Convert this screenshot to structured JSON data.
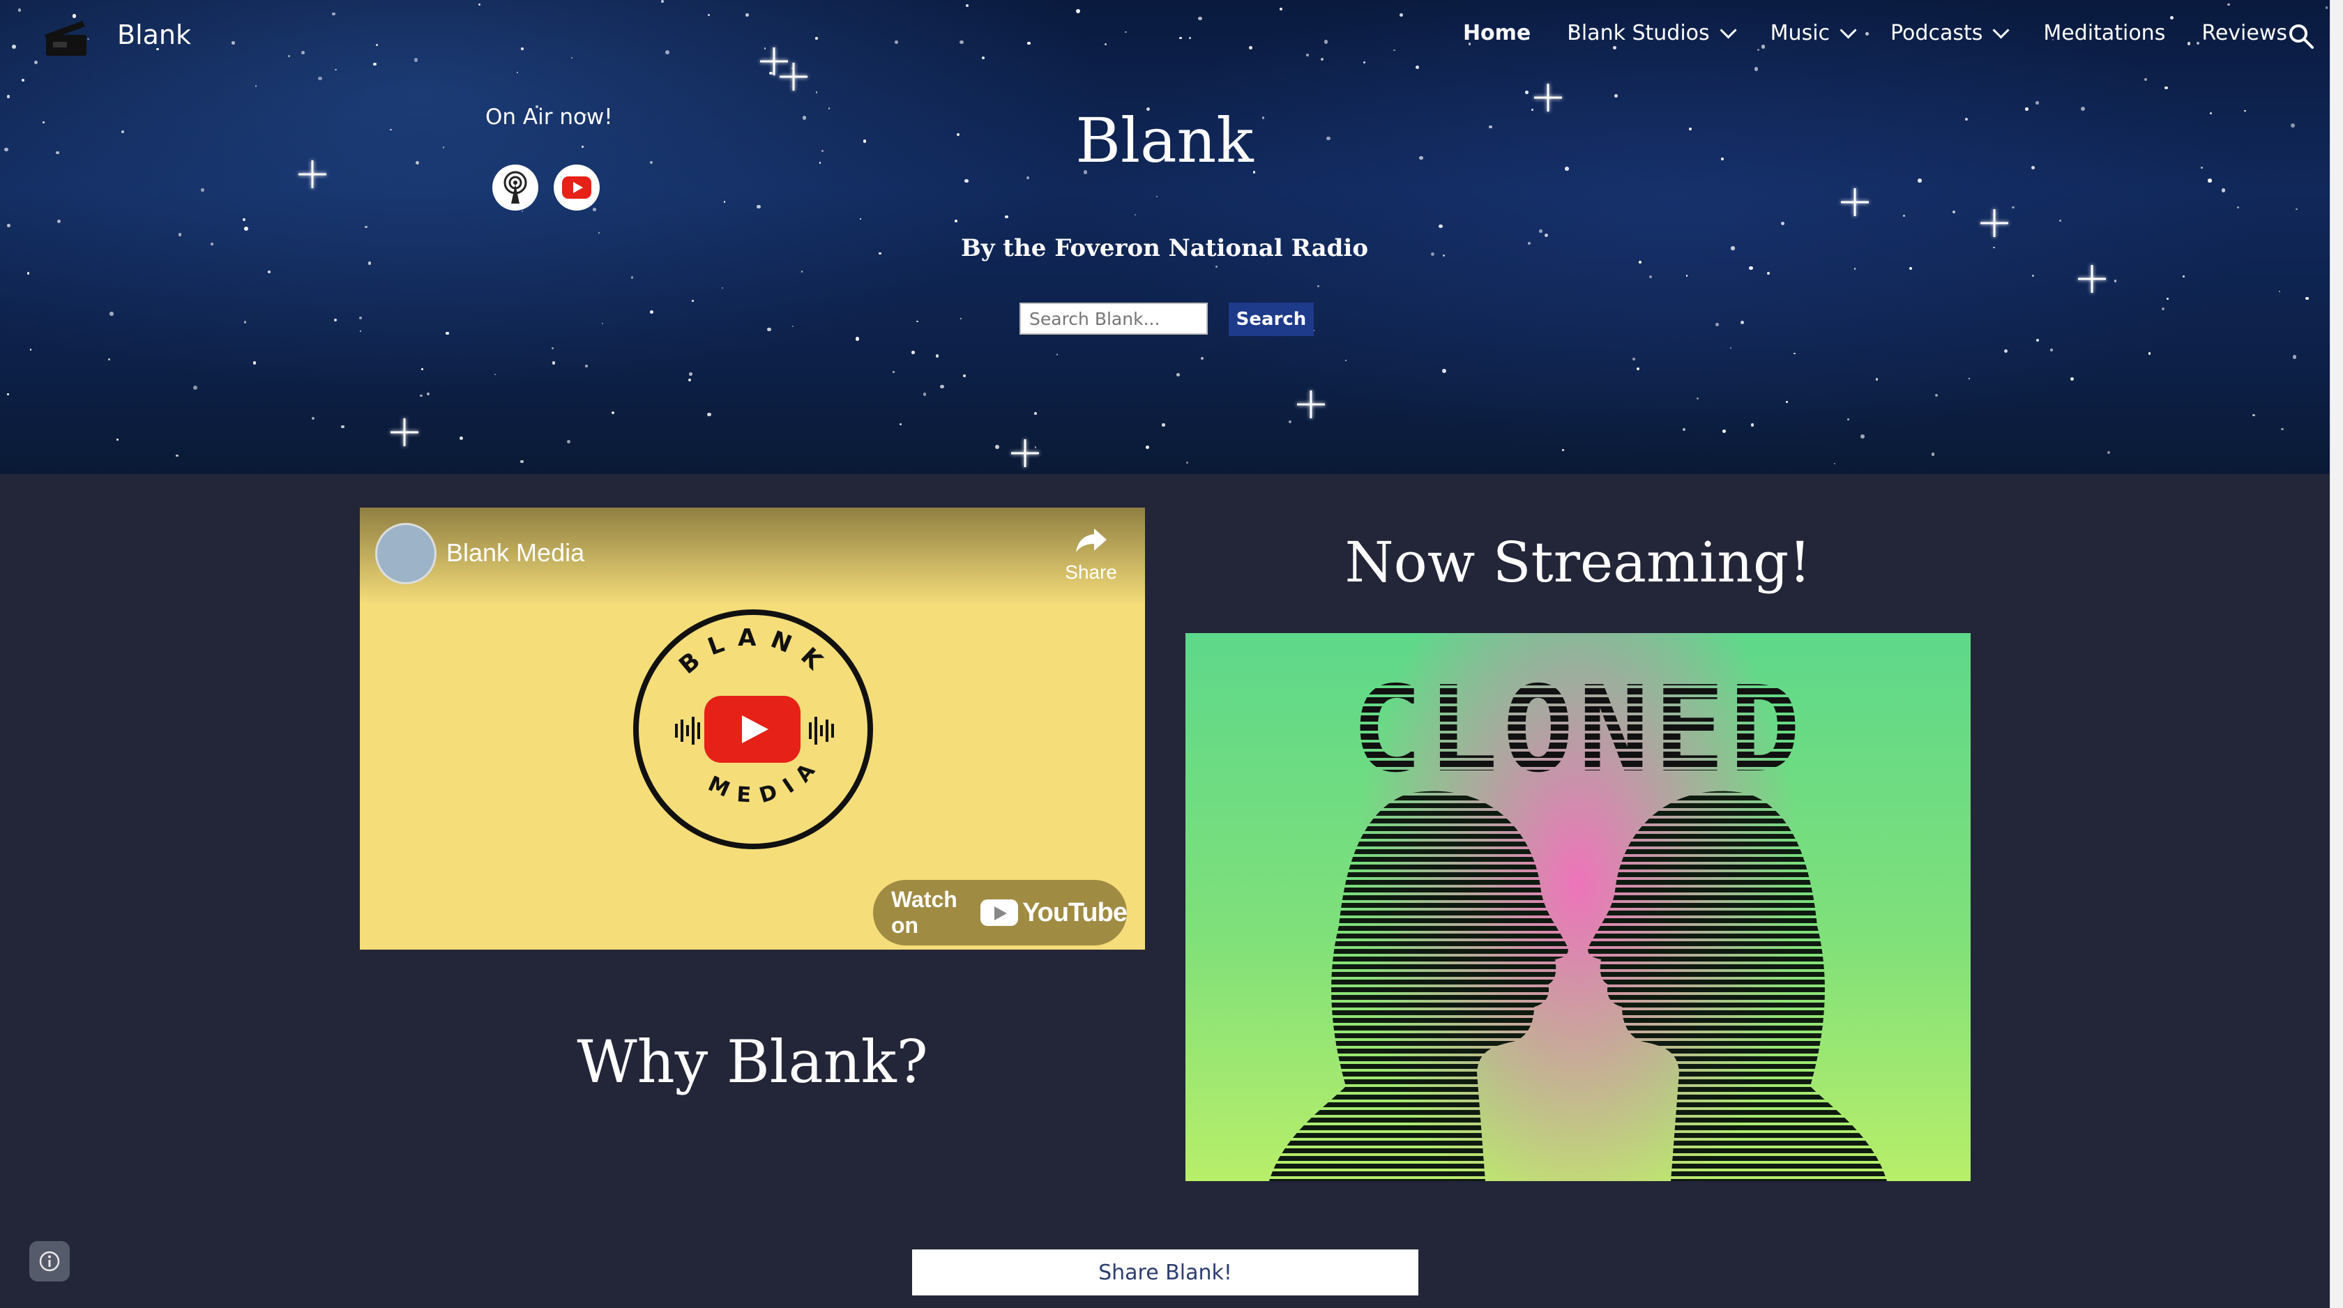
{
  "site": {
    "title": "Blank"
  },
  "nav": {
    "items": [
      {
        "label": "Home",
        "active": true,
        "dropdown": false
      },
      {
        "label": "Blank Studios",
        "active": false,
        "dropdown": true
      },
      {
        "label": "Music",
        "active": false,
        "dropdown": true
      },
      {
        "label": "Podcasts",
        "active": false,
        "dropdown": true
      },
      {
        "label": "Meditations",
        "active": false,
        "dropdown": false
      },
      {
        "label": "Reviews",
        "active": false,
        "dropdown": false
      }
    ],
    "search_icon": "search-icon"
  },
  "hero": {
    "on_air": "On Air now!",
    "social": [
      "podcast-icon",
      "youtube-icon"
    ],
    "title": "Blank",
    "subtitle": "By the Foveron National Radio",
    "search_placeholder": "Search Blank...",
    "search_button": "Search"
  },
  "video": {
    "channel_name": "Blank Media",
    "share_label": "Share",
    "badge_top": "BLANK",
    "badge_bottom": "MEDIA",
    "watch_on": "Watch on",
    "yt_word": "YouTube"
  },
  "streaming": {
    "title": "Now Streaming!",
    "cover_word": "CLONED"
  },
  "why": {
    "title": "Why Blank?"
  },
  "footer": {
    "share_button": "Share Blank!"
  },
  "colors": {
    "background": "#232638",
    "search_button": "#1e3a8a",
    "cover_pink": "#f56ebe",
    "cover_green": "#6ee07e"
  }
}
